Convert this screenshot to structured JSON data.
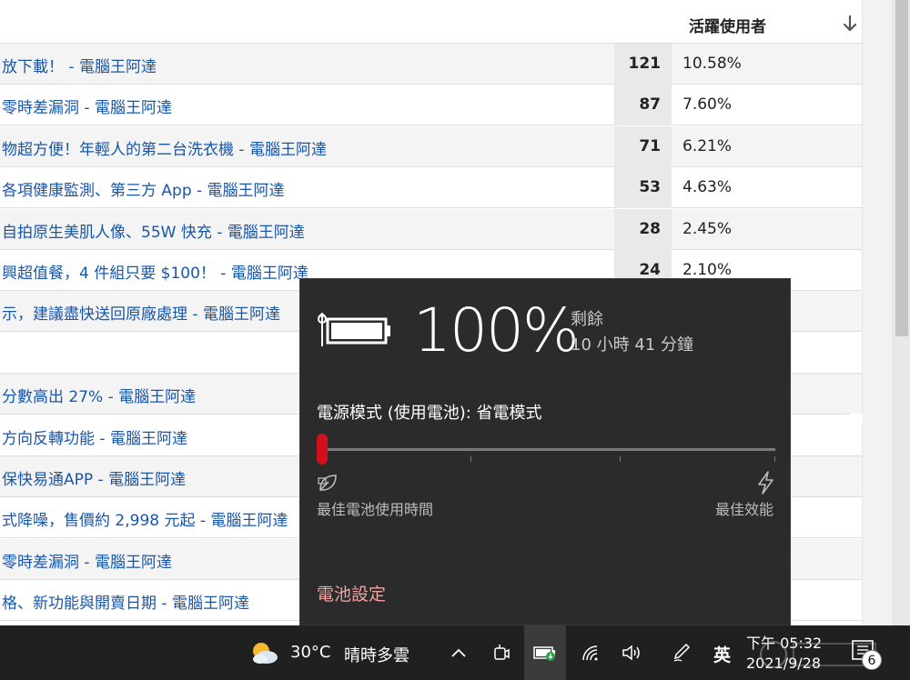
{
  "table": {
    "column_header": "活躍使用者",
    "sort_icon": "arrow-down-icon",
    "rows": [
      {
        "title": "放下載！ - 電腦王阿達",
        "count": "121",
        "pct": "10.58%"
      },
      {
        "title": "零時差漏洞 - 電腦王阿達",
        "count": "87",
        "pct": "7.60%"
      },
      {
        "title": "物超方便！年輕人的第二台洗衣機 - 電腦王阿達",
        "count": "71",
        "pct": "6.21%"
      },
      {
        "title": "各項健康監測、第三方 App - 電腦王阿達",
        "count": "53",
        "pct": "4.63%"
      },
      {
        "title": "自拍原生美肌人像、55W 快充 - 電腦王阿達",
        "count": "28",
        "pct": "2.45%"
      },
      {
        "title": "興超值餐，4 件組只要 $100！ - 電腦王阿達",
        "count": "24",
        "pct": "2.10%"
      },
      {
        "title": "示，建議盡快送回原廠處理 - 電腦王阿達",
        "count": "",
        "pct": ""
      },
      {
        "title": "",
        "count": "",
        "pct": ""
      },
      {
        "title": "分數高出 27% - 電腦王阿達",
        "count": "",
        "pct": ""
      },
      {
        "title": "方向反轉功能 - 電腦王阿達",
        "count": "",
        "pct": ""
      },
      {
        "title": "保快易通APP - 電腦王阿達",
        "count": "",
        "pct": ""
      },
      {
        "title": "式降噪，售價約 2,998 元起 - 電腦王阿達",
        "count": "",
        "pct": ""
      },
      {
        "title": "零時差漏洞 - 電腦王阿達",
        "count": "",
        "pct": ""
      },
      {
        "title": "格、新功能與開賣日期 - 電腦王阿達",
        "count": "",
        "pct": ""
      }
    ]
  },
  "battery_flyout": {
    "percent": "100%",
    "remaining_label": "剩餘",
    "remaining_time": "10 小時 41 分鐘",
    "power_mode_label": "電源模式 (使用電池): 省電模式",
    "slider_value": 0,
    "left_label": "最佳電池使用時間",
    "right_label": "最佳效能",
    "settings_link": "電池設定",
    "icons": {
      "battery": "battery-full-icon",
      "leaf": "leaf-icon",
      "bolt": "lightning-bolt-icon"
    },
    "accent_color": "#d40f1c"
  },
  "taskbar": {
    "weather_temp": "30°C",
    "weather_desc": "晴時多雲",
    "ime": "英",
    "clock_time": "下午 05:32",
    "clock_date": "2021/9/28",
    "notification_count": "6",
    "tray_icons": [
      "chevron-up-icon",
      "meet-now-icon",
      "battery-icon",
      "wifi-icon",
      "volume-icon",
      "pen-icon"
    ]
  }
}
